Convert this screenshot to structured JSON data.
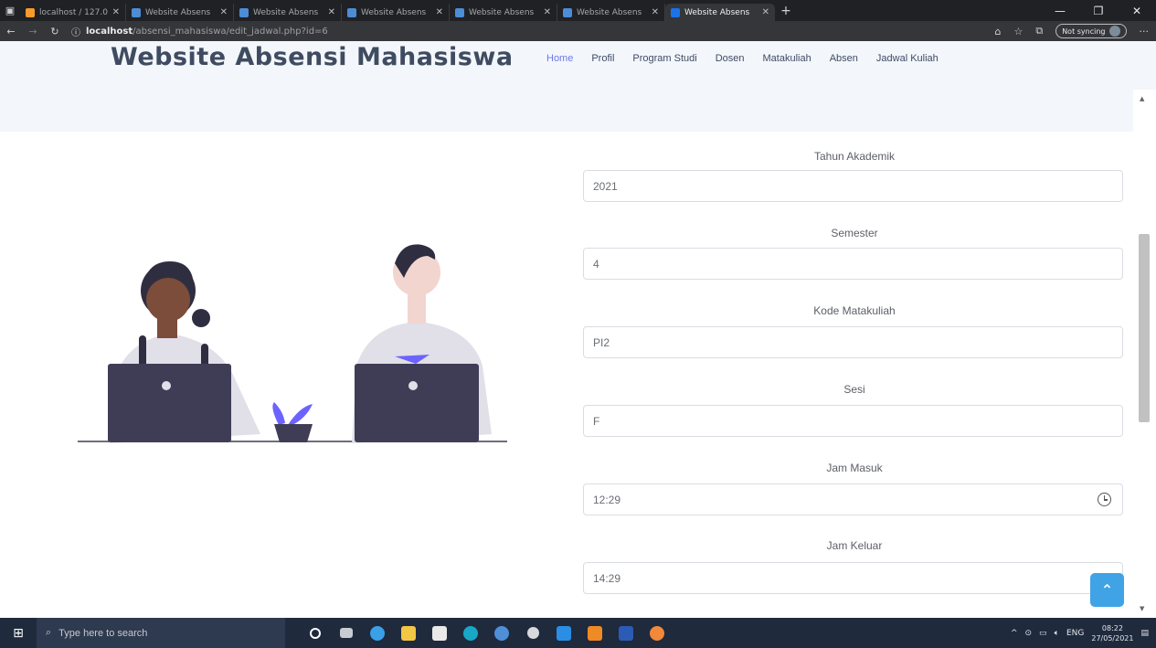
{
  "browser": {
    "tabs": [
      {
        "label": "localhost / 127.0",
        "favicon": "xampp-icon"
      },
      {
        "label": "Website Absens",
        "favicon": "page-icon"
      },
      {
        "label": "Website Absens",
        "favicon": "page-icon"
      },
      {
        "label": "Website Absens",
        "favicon": "page-icon"
      },
      {
        "label": "Website Absens",
        "favicon": "page-icon"
      },
      {
        "label": "Website Absens",
        "favicon": "page-icon"
      },
      {
        "label": "Website Absens",
        "favicon": "page-icon",
        "active": true
      }
    ],
    "url_host": "localhost",
    "url_path": "/absensi_mahasiswa/edit_jadwal.php?id=6",
    "sync_label": "Not syncing"
  },
  "site": {
    "title": "Website Absensi Mahasiswa",
    "nav": [
      {
        "label": "Home",
        "active": true
      },
      {
        "label": "Profil"
      },
      {
        "label": "Program Studi"
      },
      {
        "label": "Dosen"
      },
      {
        "label": "Matakuliah"
      },
      {
        "label": "Absen"
      },
      {
        "label": "Jadwal Kuliah"
      }
    ]
  },
  "form": {
    "fields": [
      {
        "label": "Tahun Akademik",
        "value": "2021"
      },
      {
        "label": "Semester",
        "value": "4"
      },
      {
        "label": "Kode Matakuliah",
        "value": "PI2"
      },
      {
        "label": "Sesi",
        "value": "F"
      },
      {
        "label": "Jam Masuk",
        "value": "12:29"
      },
      {
        "label": "Jam Keluar",
        "value": "14:29"
      }
    ]
  },
  "taskbar": {
    "search_placeholder": "Type here to search",
    "language": "ENG",
    "time": "08:22",
    "date": "27/05/2021"
  },
  "colors": {
    "accent": "#6f79e8",
    "back_to_top": "#3fa3e6",
    "header_bg": "#f3f6fb"
  }
}
